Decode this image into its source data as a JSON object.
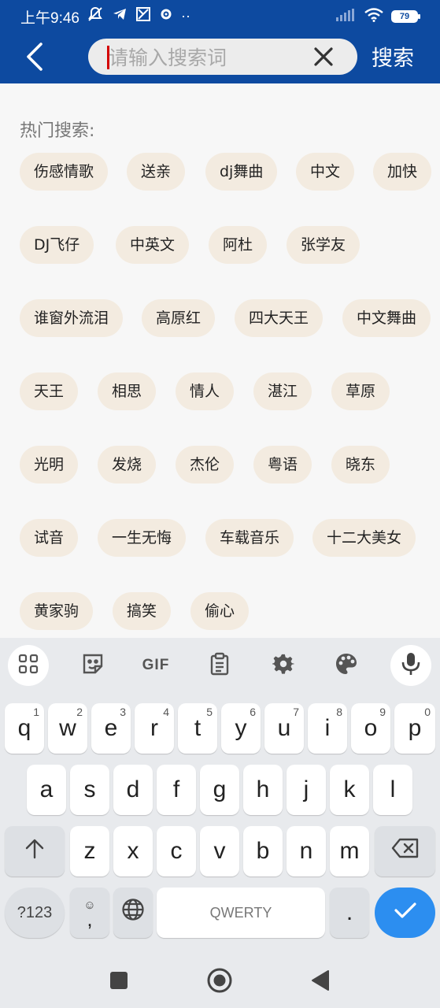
{
  "status_bar": {
    "time": "上午9:46",
    "battery": "79"
  },
  "header": {
    "search_placeholder": "请输入搜索词",
    "search_value": "",
    "search_button": "搜索"
  },
  "hot_search": {
    "title": "热门搜索:",
    "tags": [
      "伤感情歌",
      "送亲",
      "dj舞曲",
      "中文",
      "加快",
      "DJ飞仔",
      "中英文",
      "阿杜",
      "张学友",
      "谁窗外流泪",
      "高原红",
      "四大天王",
      "中文舞曲",
      "天王",
      "相思",
      "情人",
      "湛江",
      "草原",
      "光明",
      "发烧",
      "杰伦",
      "粤语",
      "晓东",
      "试音",
      "一生无悔",
      "车载音乐",
      "十二大美女",
      "黄家驹",
      "搞笑",
      "偷心"
    ]
  },
  "keyboard": {
    "toolbar": {
      "gif_label": "GIF"
    },
    "row1": [
      "q",
      "w",
      "e",
      "r",
      "t",
      "y",
      "u",
      "i",
      "o",
      "p"
    ],
    "row1_hints": [
      "1",
      "2",
      "3",
      "4",
      "5",
      "6",
      "7",
      "8",
      "9",
      "0"
    ],
    "row2": [
      "a",
      "s",
      "d",
      "f",
      "g",
      "h",
      "j",
      "k",
      "l"
    ],
    "row3": [
      "z",
      "x",
      "c",
      "v",
      "b",
      "n",
      "m"
    ],
    "symbols_key": "?123",
    "emoji_comma_key": ",",
    "space_label": "QWERTY",
    "period_key": "."
  },
  "icons": {
    "back": "chevron-left-icon",
    "clear": "close-icon",
    "grid": "apps-grid-icon",
    "sticker": "sticker-icon",
    "clipboard": "clipboard-icon",
    "settings": "gear-icon",
    "theme": "palette-icon",
    "mic": "microphone-icon",
    "shift": "shift-arrow-icon",
    "backspace": "backspace-icon",
    "globe": "globe-icon",
    "enter": "checkmark-icon"
  },
  "colors": {
    "header_bg": "#0d4aa0",
    "tag_bg": "#f3ebe0",
    "keyboard_bg": "#e8eaed",
    "enter_key": "#2c8ef0",
    "caret": "#d40000"
  }
}
